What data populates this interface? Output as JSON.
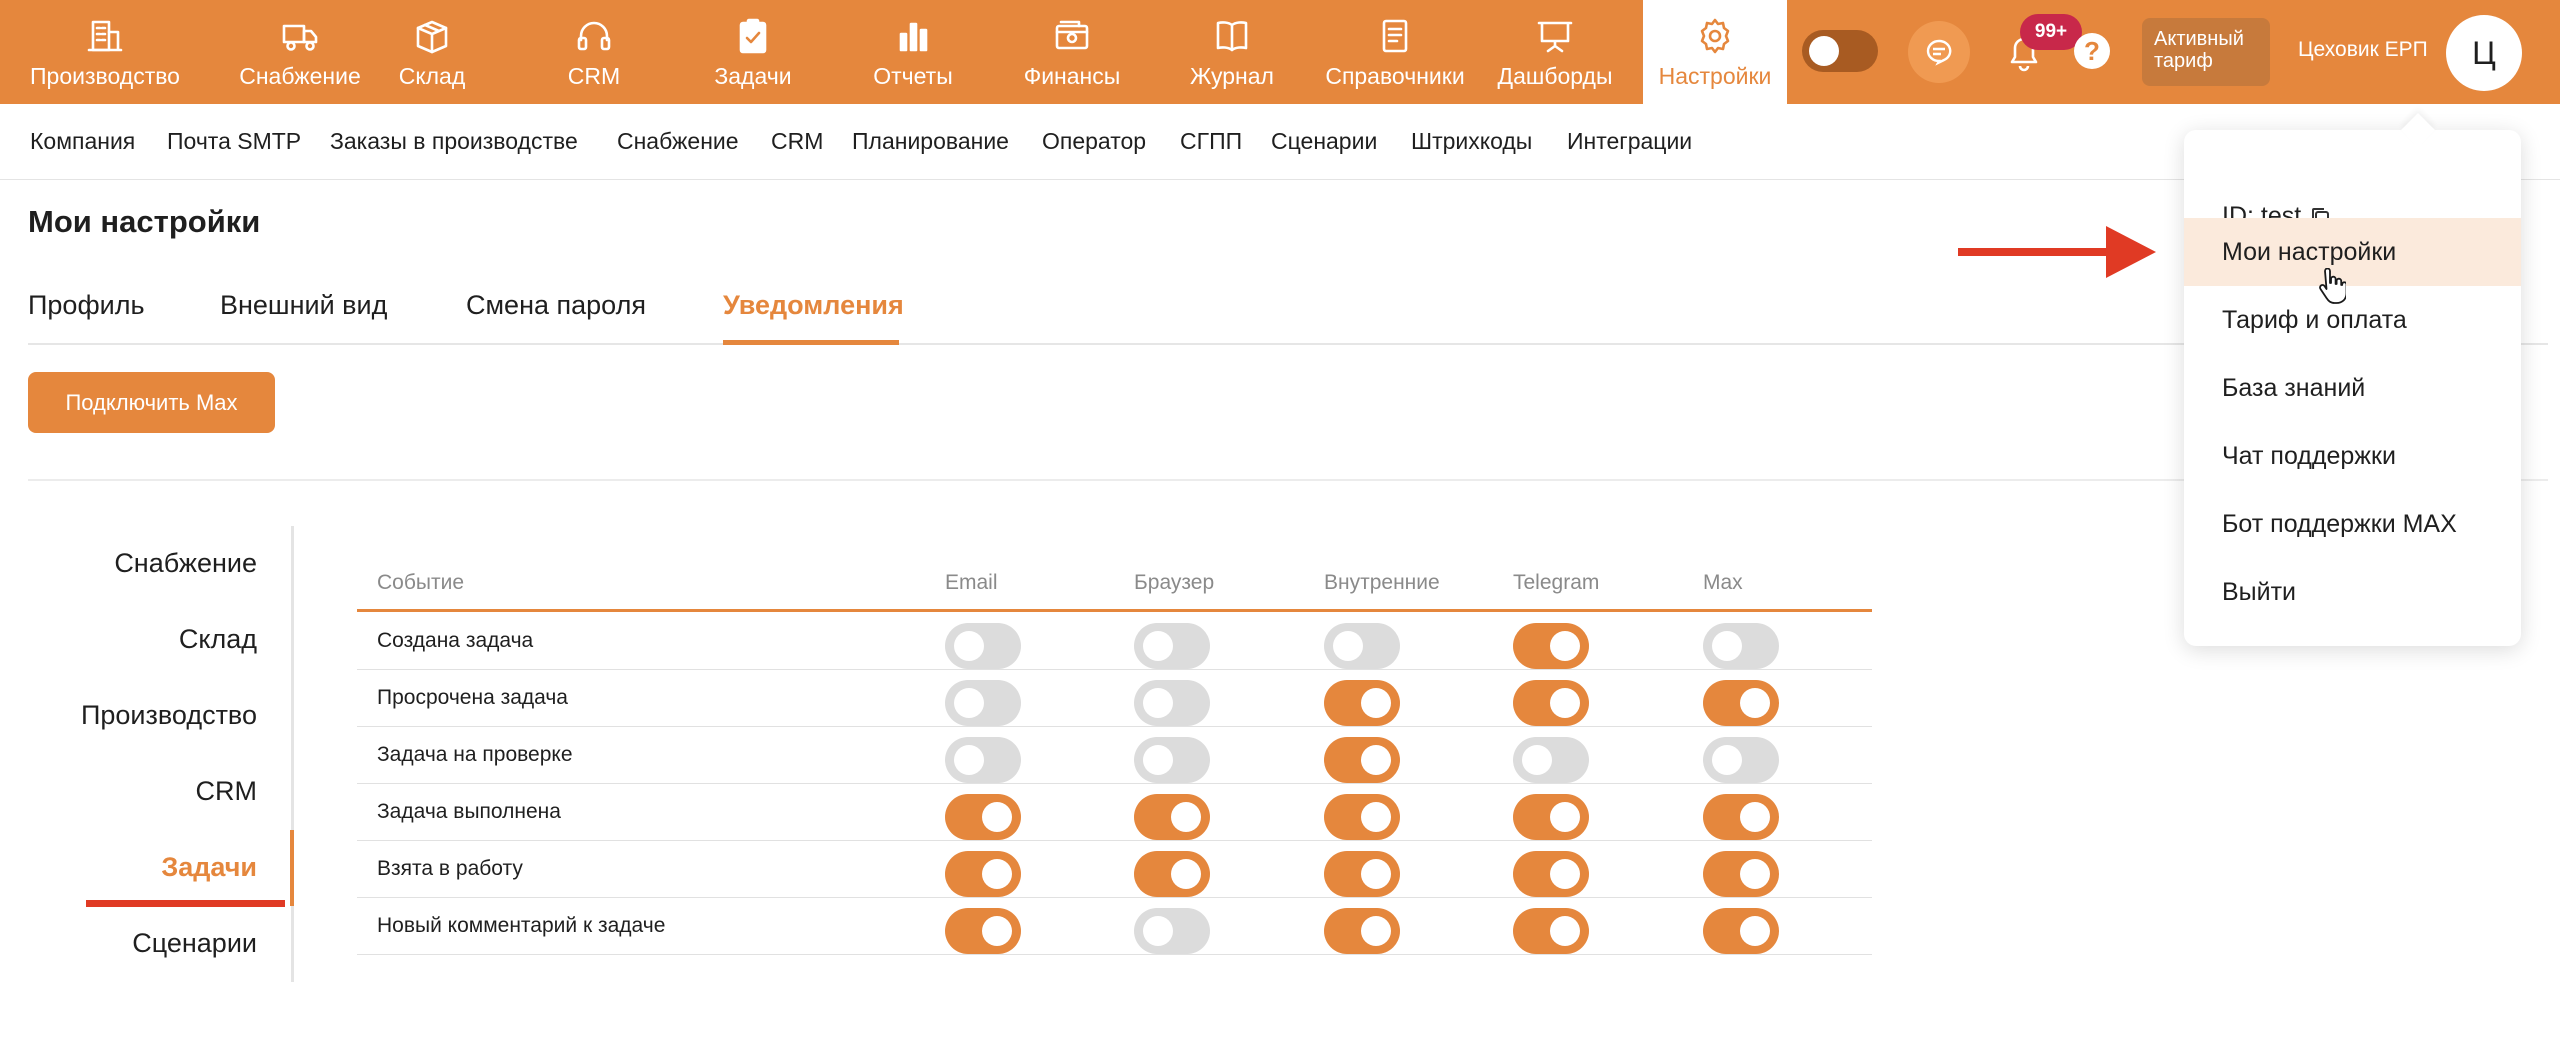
{
  "topnav": {
    "items": [
      {
        "label": "Производство",
        "icon": "building-icon"
      },
      {
        "label": "Снабжение",
        "icon": "truck-icon"
      },
      {
        "label": "Склад",
        "icon": "box-icon"
      },
      {
        "label": "CRM",
        "icon": "headset-icon"
      },
      {
        "label": "Задачи",
        "icon": "clipboard-check-icon"
      },
      {
        "label": "Отчеты",
        "icon": "bar-chart-icon"
      },
      {
        "label": "Финансы",
        "icon": "wallet-icon"
      },
      {
        "label": "Журнал",
        "icon": "book-icon"
      },
      {
        "label": "Справочники",
        "icon": "document-icon"
      },
      {
        "label": "Дашборды",
        "icon": "presentation-board-icon"
      },
      {
        "label": "Настройки",
        "icon": "gear-icon",
        "active": true
      }
    ],
    "notifications_badge": "99+",
    "help": "?",
    "tariff_label": "Активный тариф",
    "tariff_line1": "Активный",
    "tariff_line2": "тариф",
    "company_name": "Цеховик ЕРП",
    "avatar_letter": "Ц"
  },
  "submenu": {
    "items": [
      "Компания",
      "Почта SMTP",
      "Заказы в производстве",
      "Снабжение",
      "CRM",
      "Планирование",
      "Оператор",
      "СГПП",
      "Сценарии",
      "Штрихкоды",
      "Интеграции"
    ]
  },
  "page": {
    "title": "Мои настройки",
    "tabs": [
      {
        "label": "Профиль"
      },
      {
        "label": "Внешний вид"
      },
      {
        "label": "Смена пароля"
      },
      {
        "label": "Уведомления",
        "active": true
      }
    ],
    "connect_button": "Подключить Max"
  },
  "categories": [
    {
      "label": "Снабжение"
    },
    {
      "label": "Склад"
    },
    {
      "label": "Производство"
    },
    {
      "label": "CRM"
    },
    {
      "label": "Задачи",
      "active": true
    },
    {
      "label": "Сценарии"
    }
  ],
  "table": {
    "headers": [
      "Событие",
      "Email",
      "Браузер",
      "Внутренние",
      "Telegram",
      "Max"
    ],
    "rows": [
      {
        "event": "Создана задача",
        "values": [
          false,
          false,
          false,
          true,
          false
        ]
      },
      {
        "event": "Просрочена задача",
        "values": [
          false,
          false,
          true,
          true,
          true
        ]
      },
      {
        "event": "Задача на проверке",
        "values": [
          false,
          false,
          true,
          false,
          false
        ]
      },
      {
        "event": "Задача выполнена",
        "values": [
          true,
          true,
          true,
          true,
          true
        ]
      },
      {
        "event": "Взята в работу",
        "values": [
          true,
          true,
          true,
          true,
          true
        ]
      },
      {
        "event": "Новый комментарий к задаче",
        "values": [
          true,
          false,
          true,
          true,
          true
        ]
      }
    ]
  },
  "dropdown": {
    "id_label": "ID: test",
    "items": [
      "Мои настройки",
      "Тариф и оплата",
      "База знаний",
      "Чат поддержки",
      "Бот поддержки MAX",
      "Выйти"
    ],
    "hovered": "Мои настройки"
  },
  "colors": {
    "accent": "#e5873d",
    "toggle_off": "#dcdcdc",
    "badge": "#c8284a",
    "annotation_red": "#e03a24",
    "hover_bg": "#fbeadc"
  }
}
